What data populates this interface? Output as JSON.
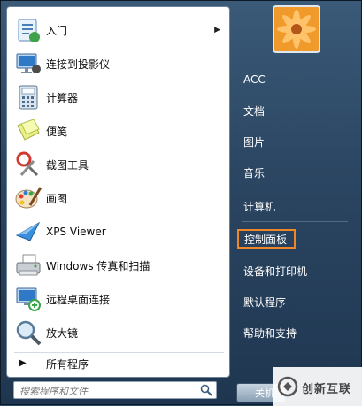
{
  "programs": [
    {
      "label": "入门",
      "icon": "getting-started-icon",
      "jump": true
    },
    {
      "label": "连接到投影仪",
      "icon": "projector-icon",
      "jump": false
    },
    {
      "label": "计算器",
      "icon": "calculator-icon",
      "jump": false
    },
    {
      "label": "便笺",
      "icon": "sticky-notes-icon",
      "jump": false
    },
    {
      "label": "截图工具",
      "icon": "snipping-tool-icon",
      "jump": false
    },
    {
      "label": "画图",
      "icon": "paint-icon",
      "jump": false
    },
    {
      "label": "XPS Viewer",
      "icon": "xps-viewer-icon",
      "jump": false
    },
    {
      "label": "Windows 传真和扫描",
      "icon": "fax-scan-icon",
      "jump": false
    },
    {
      "label": "远程桌面连接",
      "icon": "remote-desktop-icon",
      "jump": false
    },
    {
      "label": "放大镜",
      "icon": "magnifier-icon",
      "jump": false
    }
  ],
  "all_programs": "所有程序",
  "search": {
    "placeholder": "搜索程序和文件"
  },
  "right": [
    {
      "label": "ACC"
    },
    {
      "label": "文档"
    },
    {
      "label": "图片"
    },
    {
      "label": "音乐"
    },
    {
      "label": "计算机"
    },
    {
      "label": "控制面板",
      "highlighted": true
    },
    {
      "label": "设备和打印机"
    },
    {
      "label": "默认程序"
    },
    {
      "label": "帮助和支持"
    }
  ],
  "shutdown": {
    "label": "关机"
  },
  "watermark": {
    "text": "创新互联"
  },
  "colors": {
    "highlight": "#f0862a",
    "menu_bg": "#2c4763"
  }
}
